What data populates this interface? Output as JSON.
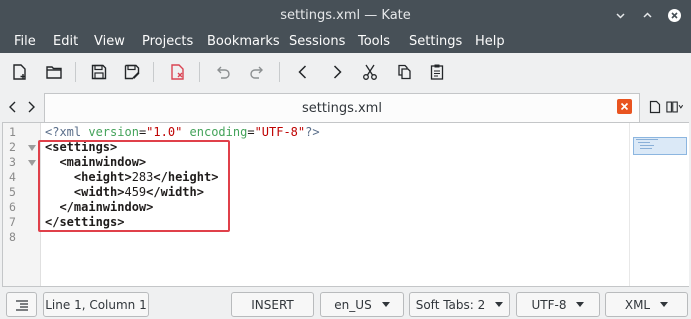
{
  "window": {
    "title": "settings.xml  — Kate"
  },
  "menu": [
    "File",
    "Edit",
    "View",
    "Projects",
    "Bookmarks",
    "Sessions",
    "Tools",
    "Settings",
    "Help"
  ],
  "toolbar": {
    "buttons": [
      "new-document-icon",
      "open-folder-icon",
      "save-icon",
      "save-as-icon",
      "close-document-icon",
      "undo-icon",
      "redo-icon",
      "back-icon",
      "forward-icon",
      "cut-icon",
      "copy-icon",
      "paste-icon"
    ]
  },
  "tab": {
    "label": "settings.xml"
  },
  "editor": {
    "line_numbers": [
      "1",
      "2",
      "3",
      "4",
      "5",
      "6",
      "7",
      "8"
    ],
    "lines": [
      {
        "pi_open": "<?xml ",
        "attr1": "version",
        "eq1": "=",
        "val1": "\"1.0\"",
        "sp": " ",
        "attr2": "encoding",
        "eq2": "=",
        "val2": "\"UTF-8\"",
        "pi_close": "?>"
      },
      {
        "indent": "",
        "tag": "<settings>"
      },
      {
        "indent": "  ",
        "tag": "<mainwindow>"
      },
      {
        "indent": "    ",
        "tag_open": "<height>",
        "text": "283",
        "tag_close": "</height>"
      },
      {
        "indent": "    ",
        "tag_open": "<width>",
        "text": "459",
        "tag_close": "</width>"
      },
      {
        "indent": "  ",
        "tag": "</mainwindow>"
      },
      {
        "indent": "",
        "tag": "</settings>"
      },
      {
        "indent": "",
        "tag": ""
      }
    ]
  },
  "status": {
    "position": "Line 1, Column 1",
    "mode": "INSERT",
    "dictionary": "en_US",
    "indent": "Soft Tabs: 2",
    "encoding": "UTF-8",
    "syntax": "XML"
  },
  "colors": {
    "titlebar_bg": "#475057",
    "highlight_box": "#e0404a",
    "tab_close": "#e95420"
  }
}
